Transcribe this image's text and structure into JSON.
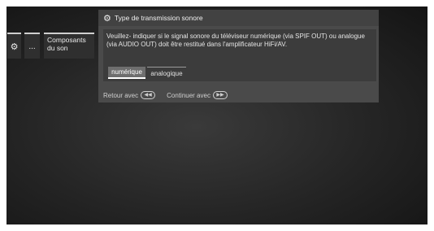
{
  "side_menu": {
    "gear_icon": "gear-icon",
    "dots_label": "...",
    "item_label_line1": "Composants",
    "item_label_line2": "du son"
  },
  "dialog": {
    "title": "Type de transmission sonore",
    "title_icon": "gears-icon",
    "message": "Veuillez- indiquer si le signal sonore du téléviseur numérique (via SPIF OUT) ou analogue (via AUDIO OUT) doit être restitué dans l'amplificateur HiFi/AV.",
    "options": [
      {
        "label": "numérique",
        "selected": true
      },
      {
        "label": "analogique",
        "selected": false
      }
    ],
    "back_label": "Retour avec",
    "back_key_icon": "rewind-key-icon",
    "continue_label": "Continuer avec",
    "continue_key_icon": "fast-forward-key-icon"
  },
  "colors": {
    "background": "#242424",
    "dialog": "#4a4a4a",
    "selected_option": "#6e6e6e",
    "text": "#e6e6e6"
  }
}
